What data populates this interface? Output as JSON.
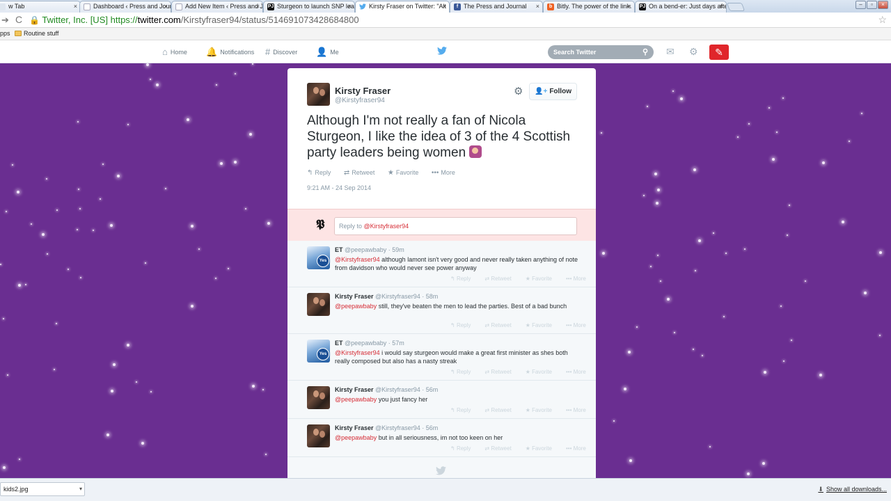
{
  "browser": {
    "tabs": [
      {
        "title": "w Tab",
        "icon": "blank-page-icon"
      },
      {
        "title": "Dashboard ‹ Press and Journ",
        "icon": "page-icon"
      },
      {
        "title": "Add New Item ‹ Press and Jo",
        "icon": "page-icon"
      },
      {
        "title": "Sturgeon to launch SNP lead",
        "icon": "pj-icon"
      },
      {
        "title": "Kirsty Fraser on Twitter: \"Alt",
        "icon": "twitter-bird-icon"
      },
      {
        "title": "The Press and Journal",
        "icon": "facebook-icon"
      },
      {
        "title": "Bitly. The power of the link.",
        "icon": "bitly-icon"
      },
      {
        "title": "On a bend-er: Just days afte",
        "icon": "pj-icon"
      }
    ],
    "tab_close": "×",
    "url": {
      "ev_label": "Twitter, Inc. [US]",
      "protocol": "https://",
      "host": "twitter.com",
      "path": "/Kirstyfraser94/status/514691073428684800"
    },
    "bookmarks": [
      {
        "label": "pps"
      },
      {
        "label": "Routine stuff"
      }
    ],
    "window_buttons": [
      "–",
      "▫",
      "×"
    ]
  },
  "twitter_nav": {
    "items": [
      {
        "label": "Home",
        "icon": "⌂"
      },
      {
        "label": "Notifications",
        "icon": "🔔"
      },
      {
        "label": "Discover",
        "icon": "#"
      },
      {
        "label": "Me",
        "icon": "👤"
      }
    ],
    "search_placeholder": "Search Twitter"
  },
  "tweet": {
    "name": "Kirsty Fraser",
    "handle": "@Kirstyfraser94",
    "follow_label": "Follow",
    "text": "Although I'm not really a fan of Nicola Sturgeon, I like the idea of 3 of the 4 Scottish party leaders being women",
    "actions": {
      "reply": "Reply",
      "retweet": "Retweet",
      "favorite": "Favorite",
      "more": "More"
    },
    "timestamp": "9:21 AM - 24 Sep 2014",
    "reply_prompt_prefix": "Reply to ",
    "reply_prompt_mention": "@Kirstyfraser94"
  },
  "replies": [
    {
      "name": "ET",
      "handle": "@peepawbaby",
      "time": "59m",
      "mention": "@Kirstyfraser94",
      "text": " although lamont isn't very good and never really taken anything of note from davidson who would never see power anyway",
      "avatar": "yes"
    },
    {
      "name": "Kirsty Fraser",
      "handle": "@Kirstyfraser94",
      "time": "58m",
      "mention": "@peepawbaby",
      "text": " still, they've beaten the men to lead the parties. Best of a bad bunch",
      "avatar": "kirsty"
    },
    {
      "name": "ET",
      "handle": "@peepawbaby",
      "time": "57m",
      "mention": "@Kirstyfraser94",
      "text": " i would say sturgeon would make a great first minister as shes both really composed but also has a nasty streak",
      "avatar": "yes"
    },
    {
      "name": "Kirsty Fraser",
      "handle": "@Kirstyfraser94",
      "time": "56m",
      "mention": "@peepawbaby",
      "text": " you just fancy her",
      "avatar": "kirsty"
    },
    {
      "name": "Kirsty Fraser",
      "handle": "@Kirstyfraser94",
      "time": "56m",
      "mention": "@peepawbaby",
      "text": " but in all seriousness, im not too keen on her",
      "avatar": "kirsty"
    }
  ],
  "reply_actions": {
    "reply": "Reply",
    "retweet": "Retweet",
    "favorite": "Favorite",
    "more": "More"
  },
  "yes_badge": "Yes",
  "downloads": {
    "file": "kids2.jpg",
    "show_all": "Show all downloads..."
  },
  "colors": {
    "background": "#6a2e91",
    "link": "#d62d36",
    "twitter_blue": "#55acee",
    "compose_red": "#e0262b"
  }
}
